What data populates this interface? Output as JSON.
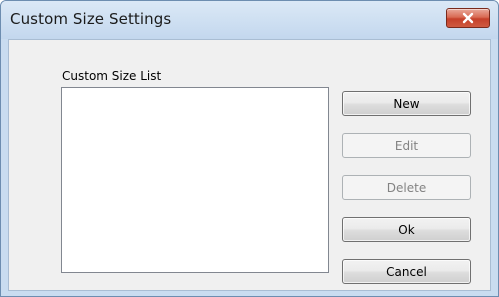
{
  "window": {
    "title": "Custom Size Settings"
  },
  "list": {
    "label": "Custom Size List",
    "items": []
  },
  "buttons": {
    "new": "New",
    "edit": "Edit",
    "delete": "Delete",
    "ok": "Ok",
    "cancel": "Cancel"
  },
  "colors": {
    "close_button": "#c5402a",
    "frame": "#c9dcf0",
    "client": "#f0f0f0"
  },
  "icons": {
    "close": "close-icon"
  }
}
